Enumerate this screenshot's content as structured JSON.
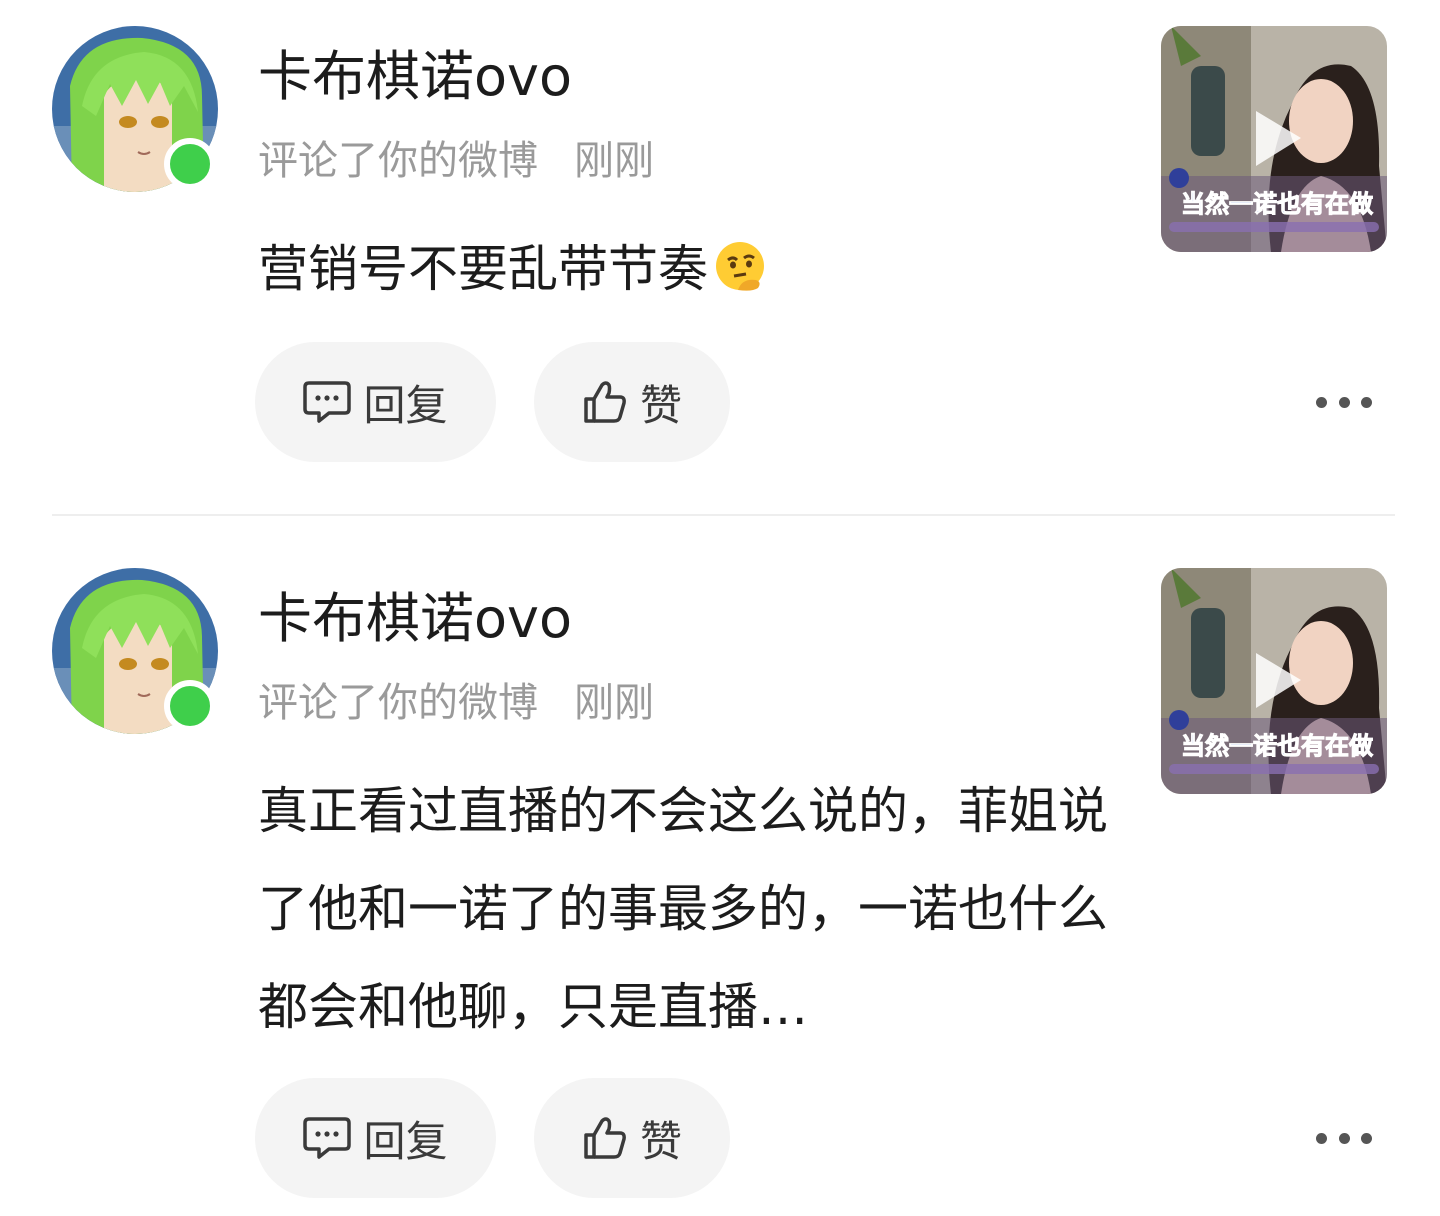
{
  "notifications": [
    {
      "username": "卡布棋诺ovo",
      "action": "评论了你的微博",
      "time": "刚刚",
      "content": "营销号不要乱带节奏",
      "emoji": "thinking-face-emoji",
      "thumbnail": {
        "caption": "当然一诺也有在做"
      },
      "reply_label": "回复",
      "like_label": "赞"
    },
    {
      "username": "卡布棋诺ovo",
      "action": "评论了你的微博",
      "time": "刚刚",
      "content": "真正看过直播的不会这么说的，菲姐说了他和一诺了的事最多的，一诺也什么都会和他聊，只是直播…",
      "thumbnail": {
        "caption": "当然一诺也有在做"
      },
      "reply_label": "回复",
      "like_label": "赞"
    }
  ],
  "colors": {
    "online": "#3fcf4b",
    "button_bg": "#f4f4f4",
    "meta_text": "#9a9a9a",
    "caption": "#1e5bd8"
  }
}
